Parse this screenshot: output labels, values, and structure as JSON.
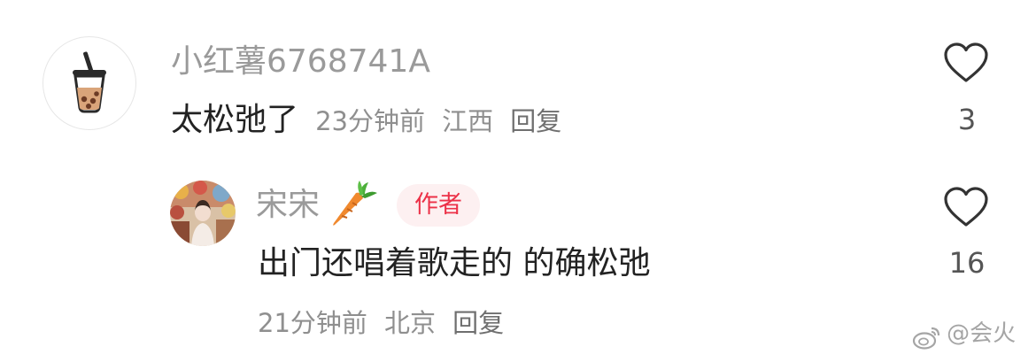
{
  "comments": [
    {
      "username": "小红薯6768741A",
      "text": "太松弛了",
      "time": "23分钟前",
      "location": "江西",
      "reply_label": "回复",
      "likes": "3",
      "avatar_icon": "bubble-tea-icon"
    },
    {
      "username": "宋宋",
      "username_emoji": "carrot-icon",
      "badge": "作者",
      "text": "出门还唱着歌走的 的确松弛",
      "time": "21分钟前",
      "location": "北京",
      "reply_label": "回复",
      "likes": "16",
      "avatar_icon": "photo-avatar"
    }
  ],
  "watermark": "@会火",
  "colors": {
    "username": "#9a9a9a",
    "content": "#222222",
    "meta": "#8f8f8f",
    "badge_text": "#ec3148",
    "badge_bg": "#fdf0f1"
  }
}
